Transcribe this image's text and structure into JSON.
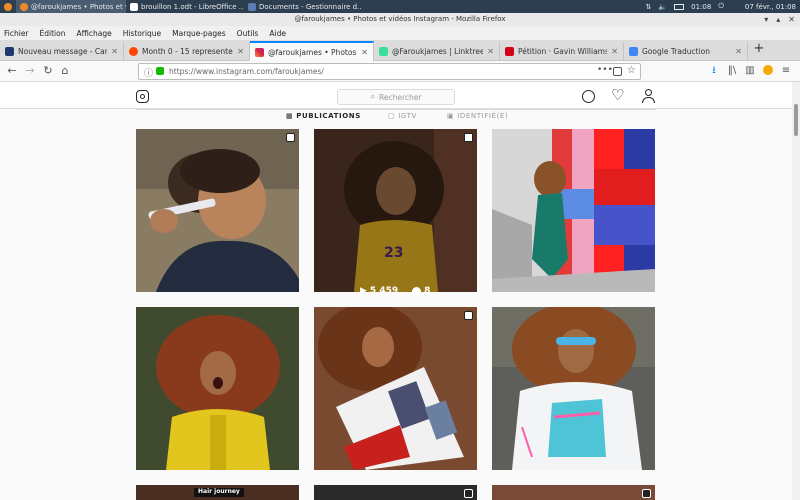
{
  "taskbar": {
    "items": [
      {
        "label": "@faroukjames • Photos et vi...",
        "color": "#e4405f"
      },
      {
        "label": "brouillon 1.odt - LibreOffice ...",
        "color": "#ffffff"
      },
      {
        "label": "Documents - Gestionnaire d...",
        "color": "#5b7db1"
      }
    ],
    "clock": "01:08",
    "date": "07 févr., 01:08"
  },
  "window": {
    "title": "@faroukjames • Photos et vidéos Instagram - Mozilla Firefox"
  },
  "menubar": {
    "items": [
      "Fichier",
      "Édition",
      "Affichage",
      "Historique",
      "Marque-pages",
      "Outils",
      "Aide"
    ]
  },
  "tabs": [
    {
      "label": "Nouveau message - CanalBlog",
      "favicon_color": "#1d3a6e"
    },
    {
      "label": "Month 0 - 15 represented in 3",
      "favicon_color": "#ff4500"
    },
    {
      "label": "@faroukjames • Photos et vid",
      "favicon_color": "#c13584"
    },
    {
      "label": "@Faroukjames | Linktree",
      "favicon_color": "#39e09b"
    },
    {
      "label": "Pétition · Gavin Williamson · C",
      "favicon_color": "#d0021b"
    },
    {
      "label": "Google Traduction",
      "favicon_color": "#4285f4"
    }
  ],
  "nav": {
    "url": "https://www.instagram.com/faroukjames/"
  },
  "instagram": {
    "search_placeholder": "Rechercher",
    "tabs": [
      "PUBLICATIONS",
      "IGTV",
      "IDENTIFIÉ(E)"
    ],
    "hover_stats": {
      "views": "5 459",
      "comments": "8"
    },
    "partial_label": "Hair journey"
  },
  "colors": {
    "accent": "#0a84ff",
    "taskbar": "#2d3e50"
  }
}
